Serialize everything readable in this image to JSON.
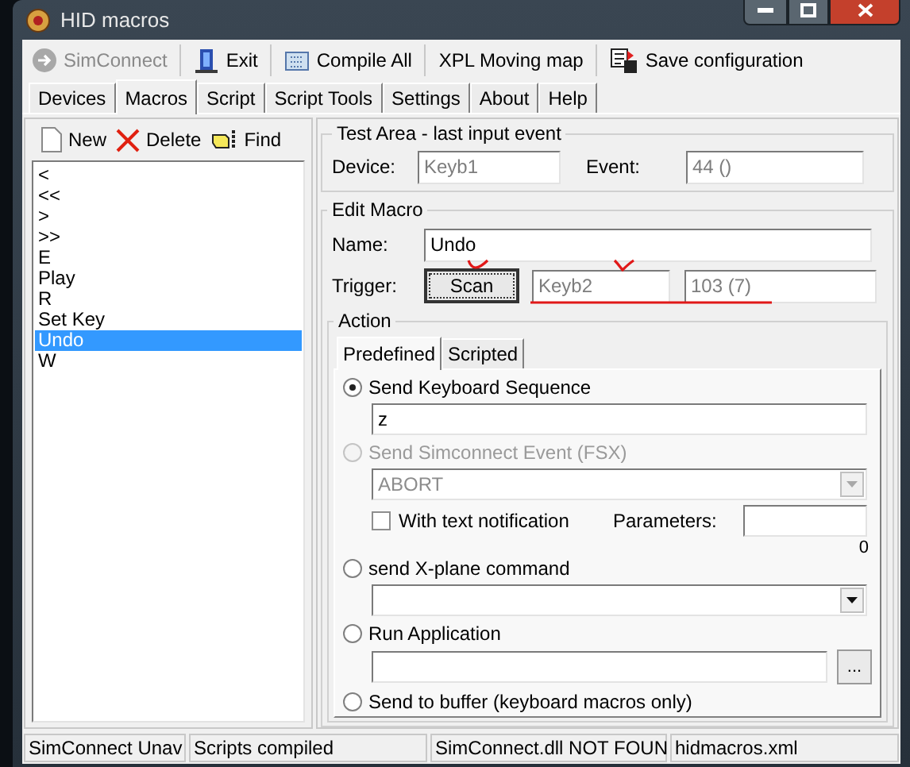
{
  "window": {
    "title": "HID macros"
  },
  "toolbar": [
    {
      "kind": "simconnect",
      "label": "SimConnect",
      "disabled": true
    },
    {
      "kind": "exit",
      "label": "Exit",
      "disabled": false
    },
    {
      "kind": "compile",
      "label": "Compile All",
      "disabled": false
    },
    {
      "kind": "text",
      "label": "XPL Moving map",
      "disabled": false
    },
    {
      "kind": "save",
      "label": "Save configuration",
      "disabled": false
    }
  ],
  "tabs": [
    {
      "label": "Devices",
      "selected": false
    },
    {
      "label": "Macros",
      "selected": true
    },
    {
      "label": "Script",
      "selected": false
    },
    {
      "label": "Script Tools",
      "selected": false
    },
    {
      "label": "Settings",
      "selected": false
    },
    {
      "label": "About",
      "selected": false
    },
    {
      "label": "Help",
      "selected": false
    }
  ],
  "macro_toolbar": [
    {
      "kind": "new",
      "label": "New"
    },
    {
      "kind": "delete",
      "label": "Delete"
    },
    {
      "kind": "find",
      "label": "Find"
    }
  ],
  "macros": [
    {
      "label": "<",
      "selected": false
    },
    {
      "label": "<<",
      "selected": false
    },
    {
      "label": ">",
      "selected": false
    },
    {
      "label": ">>",
      "selected": false
    },
    {
      "label": "E",
      "selected": false
    },
    {
      "label": "Play",
      "selected": false
    },
    {
      "label": "R",
      "selected": false
    },
    {
      "label": "Set Key",
      "selected": false
    },
    {
      "label": "Undo",
      "selected": true
    },
    {
      "label": "W",
      "selected": false
    }
  ],
  "test_area": {
    "title": "Test Area - last input event",
    "device_label": "Device:",
    "device_value": "Keyb1",
    "event_label": "Event:",
    "event_value": "44 ()"
  },
  "edit_macro": {
    "title": "Edit Macro",
    "name_label": "Name:",
    "name_value": "Undo",
    "trigger_label": "Trigger:",
    "scan_button": "Scan",
    "trigger_device": "Keyb2",
    "trigger_event": "103 (7)"
  },
  "action": {
    "title": "Action",
    "tabs": [
      {
        "label": "Predefined",
        "selected": true
      },
      {
        "label": "Scripted",
        "selected": false
      }
    ],
    "options": [
      {
        "kind": "keyboard",
        "label": "Send Keyboard Sequence",
        "selected": true,
        "disabled": false,
        "value": "z"
      },
      {
        "kind": "simconnect",
        "label": "Send Simconnect Event (FSX)",
        "selected": false,
        "disabled": true,
        "value": "ABORT",
        "checkbox": {
          "label": "With text notification",
          "checked": false
        },
        "parameters_label": "Parameters:",
        "count": "0"
      },
      {
        "kind": "xplane",
        "label": "send X-plane command",
        "selected": false,
        "disabled": false
      },
      {
        "kind": "application",
        "label": "Run Application",
        "selected": false,
        "disabled": false,
        "browse_button": "..."
      },
      {
        "kind": "buffer",
        "label": "Send to buffer (keyboard macros only)",
        "selected": false,
        "disabled": false
      }
    ]
  },
  "status_bar": [
    "SimConnect Unav",
    "Scripts compiled",
    "SimConnect.dll NOT FOUN",
    "hidmacros.xml"
  ]
}
